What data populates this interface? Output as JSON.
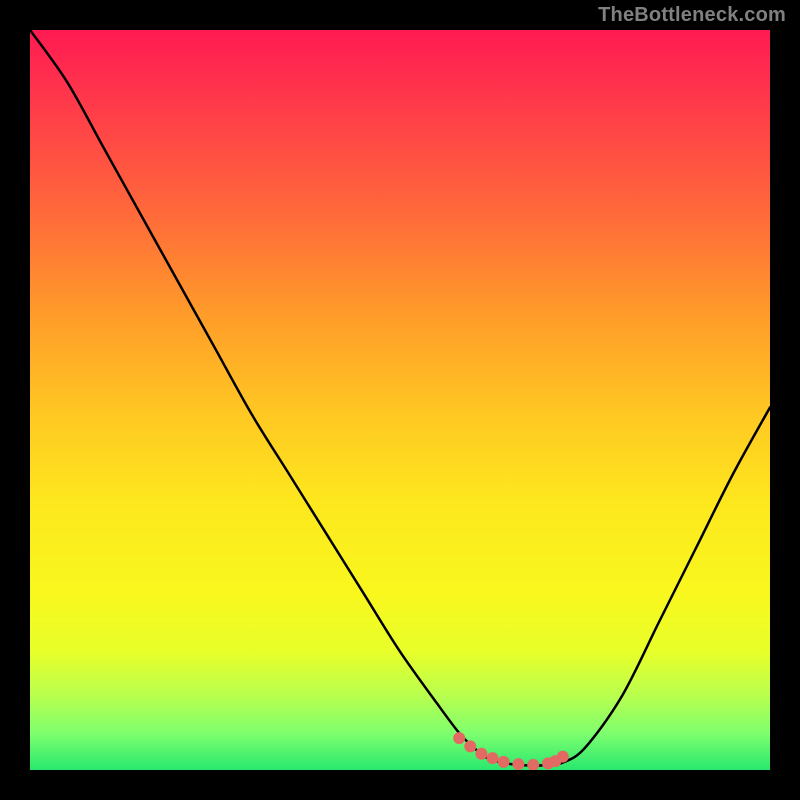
{
  "attribution": "TheBottleneck.com",
  "colors": {
    "background": "#000000",
    "curve": "#000000",
    "marker": "#e36a63",
    "attribution_text": "#808080"
  },
  "chart_data": {
    "type": "line",
    "title": "",
    "xlabel": "",
    "ylabel": "",
    "xlim": [
      0,
      100
    ],
    "ylim": [
      0,
      100
    ],
    "x": [
      0,
      5,
      10,
      15,
      20,
      25,
      30,
      35,
      40,
      45,
      50,
      55,
      58,
      60,
      62,
      65,
      68,
      70,
      72,
      75,
      80,
      85,
      90,
      95,
      100
    ],
    "y": [
      100,
      93,
      84,
      75,
      66,
      57,
      48,
      40,
      32,
      24,
      16,
      9,
      5,
      3,
      1.5,
      0.8,
      0.6,
      0.7,
      1,
      3,
      10,
      20,
      30,
      40,
      49
    ],
    "markers": {
      "x": [
        58,
        59.5,
        61,
        62.5,
        64,
        66,
        68,
        70,
        71,
        72
      ],
      "y": [
        4.3,
        3.2,
        2.2,
        1.6,
        1.1,
        0.8,
        0.7,
        0.9,
        1.2,
        1.8
      ],
      "radius": 6
    },
    "note": "Background is a vertical heat gradient (red at top → green at bottom) representing bottleneck severity; no axis ticks or labels are rendered."
  }
}
